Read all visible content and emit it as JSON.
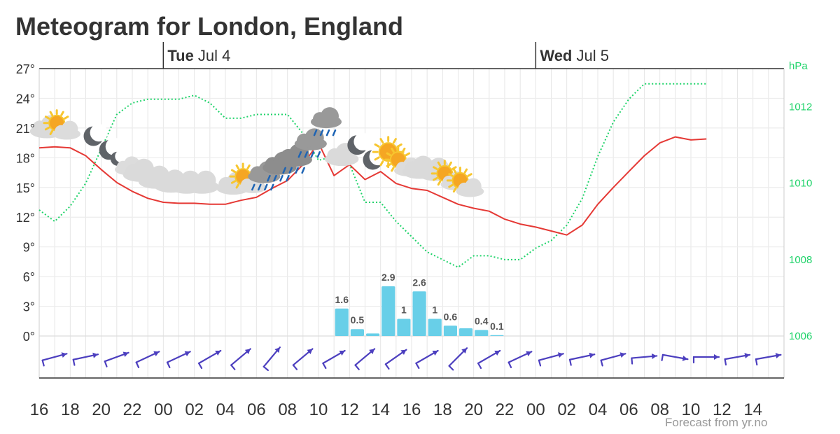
{
  "title": "Meteogram for London, England",
  "credit": "Forecast from yr.no",
  "colors": {
    "temperature": "#e53935",
    "pressure": "#1fd36a",
    "precipitation": "#68cfe8",
    "wind": "#4c3fbf",
    "grid": "#e6e6e6",
    "axis": "#333333"
  },
  "days": [
    {
      "weekday": "Tue",
      "date": "Jul 4",
      "at": "00"
    },
    {
      "weekday": "Wed",
      "date": "Jul 5",
      "at": "00"
    }
  ],
  "chart_data": {
    "type": "line",
    "x_axis": {
      "labels": [
        "16",
        "18",
        "20",
        "22",
        "00",
        "02",
        "04",
        "06",
        "08",
        "10",
        "12",
        "14",
        "16",
        "18",
        "20",
        "22",
        "00",
        "02",
        "04",
        "06",
        "08",
        "10",
        "12",
        "14"
      ]
    },
    "y_axis_left": {
      "ticks": [
        "0°",
        "3°",
        "6°",
        "9°",
        "12°",
        "15°",
        "18°",
        "21°",
        "24°",
        "27°"
      ],
      "range": [
        0,
        27
      ]
    },
    "y_axis_right": {
      "unit": "hPa",
      "ticks": [
        "1006",
        "1008",
        "1010",
        "1012"
      ],
      "range": [
        1006,
        1013
      ]
    },
    "series": [
      {
        "kind": "temperature",
        "hours": [
          16,
          17,
          18,
          19,
          20,
          21,
          22,
          23,
          24,
          25,
          26,
          27,
          28,
          29,
          30,
          31,
          32,
          33,
          34,
          35,
          36,
          37,
          38,
          39,
          40,
          41,
          42,
          43,
          44,
          45,
          46,
          47,
          48,
          49,
          50,
          51,
          52,
          53,
          54,
          55,
          56,
          57,
          58,
          59,
          60,
          61,
          62,
          63,
          64
        ],
        "values": [
          19,
          19.1,
          19,
          18.2,
          16.8,
          15.5,
          14.6,
          13.9,
          13.5,
          13.4,
          13.4,
          13.3,
          13.3,
          13.7,
          14,
          14.9,
          15.7,
          17.3,
          19.5,
          16.2,
          17.3,
          15.8,
          16.6,
          15.4,
          14.9,
          14.7,
          14,
          13.3,
          12.9,
          12.6,
          11.8,
          11.3,
          11,
          10.6,
          10.2,
          11.2,
          13.3,
          15,
          16.6,
          18.2,
          19.5,
          20.1,
          19.8,
          19.9,
          null,
          null,
          null,
          null,
          null
        ]
      },
      {
        "kind": "pressure",
        "hours": [
          16,
          17,
          18,
          19,
          20,
          21,
          22,
          23,
          24,
          25,
          26,
          27,
          28,
          29,
          30,
          31,
          32,
          33,
          34,
          35,
          36,
          37,
          38,
          39,
          40,
          41,
          42,
          43,
          44,
          45,
          46,
          47,
          48,
          49,
          50,
          51,
          52,
          53,
          54,
          55,
          56,
          57,
          58,
          59,
          60,
          61,
          62,
          63,
          64
        ],
        "values": [
          1009.3,
          1009,
          1009.4,
          1010,
          1010.9,
          1011.8,
          1012.1,
          1012.2,
          1012.2,
          1012.2,
          1012.3,
          1012.1,
          1011.7,
          1011.7,
          1011.8,
          1011.8,
          1011.8,
          1011.3,
          1010.6,
          1010.7,
          1010.5,
          1009.5,
          1009.5,
          1009,
          1008.6,
          1008.2,
          1008,
          1007.8,
          1008.1,
          1008.1,
          1008,
          1008,
          1008.3,
          1008.5,
          1008.9,
          1009.6,
          1010.7,
          1011.6,
          1012.2,
          1012.6,
          1012.6,
          1012.6,
          1012.6,
          1012.6,
          null,
          null,
          null,
          null,
          null
        ]
      }
    ],
    "precipitation": {
      "unit": "mm",
      "bars": [
        {
          "hour": 35,
          "value": 1.6,
          "label": "1.6"
        },
        {
          "hour": 36,
          "value": 0.4,
          "label": "0.5"
        },
        {
          "hour": 37,
          "value": 0.15,
          "label": ""
        },
        {
          "hour": 38,
          "value": 2.9,
          "label": "2.9"
        },
        {
          "hour": 39,
          "value": 1.0,
          "label": "1"
        },
        {
          "hour": 40,
          "value": 2.6,
          "label": "2.6"
        },
        {
          "hour": 41,
          "value": 1.0,
          "label": "1"
        },
        {
          "hour": 42,
          "value": 0.6,
          "label": "0.6"
        },
        {
          "hour": 43,
          "value": 0.45,
          "label": ""
        },
        {
          "hour": 44,
          "value": 0.35,
          "label": "0.4"
        },
        {
          "hour": 45,
          "value": 0.05,
          "label": "0.1"
        }
      ]
    },
    "wind": {
      "hours": [
        16,
        18,
        20,
        22,
        24,
        26,
        28,
        30,
        32,
        34,
        36,
        38,
        40,
        42,
        44,
        46,
        48,
        50,
        52,
        54,
        56,
        58,
        60,
        62
      ],
      "direction_deg": [
        255,
        258,
        250,
        245,
        245,
        240,
        230,
        220,
        230,
        240,
        230,
        235,
        240,
        225,
        240,
        245,
        255,
        258,
        255,
        265,
        280,
        270,
        260,
        260
      ]
    },
    "weather_symbols": [
      {
        "hour": 16,
        "icon": "cloudy-icon"
      },
      {
        "hour": 17,
        "icon": "partly-cloudy-day-icon"
      },
      {
        "hour": 19,
        "icon": "clear-night-icon"
      },
      {
        "hour": 20,
        "icon": "clear-night-icon"
      },
      {
        "hour": 21,
        "icon": "partly-cloudy-night-icon"
      },
      {
        "hour": 22,
        "icon": "cloudy-icon"
      },
      {
        "hour": 23,
        "icon": "cloudy-icon"
      },
      {
        "hour": 24,
        "icon": "cloudy-icon"
      },
      {
        "hour": 25,
        "icon": "cloudy-icon"
      },
      {
        "hour": 26,
        "icon": "cloudy-icon"
      },
      {
        "hour": 28,
        "icon": "cloudy-icon"
      },
      {
        "hour": 29,
        "icon": "partly-cloudy-day-icon"
      },
      {
        "hour": 30,
        "icon": "light-rain-icon"
      },
      {
        "hour": 31,
        "icon": "rain-icon"
      },
      {
        "hour": 32,
        "icon": "rain-icon"
      },
      {
        "hour": 33,
        "icon": "light-rain-icon"
      },
      {
        "hour": 34,
        "icon": "light-rain-night-icon"
      },
      {
        "hour": 35,
        "icon": "cloudy-icon"
      },
      {
        "hour": 36,
        "icon": "clear-night-icon"
      },
      {
        "hour": 37,
        "icon": "clear-night-icon"
      },
      {
        "hour": 38,
        "icon": "clear-day-icon"
      },
      {
        "hour": 39,
        "icon": "partly-cloudy-day-icon"
      },
      {
        "hour": 40,
        "icon": "cloudy-icon"
      },
      {
        "hour": 41,
        "icon": "cloudy-icon"
      },
      {
        "hour": 42,
        "icon": "partly-cloudy-day-icon"
      },
      {
        "hour": 43,
        "icon": "partly-cloudy-day-icon"
      }
    ]
  }
}
